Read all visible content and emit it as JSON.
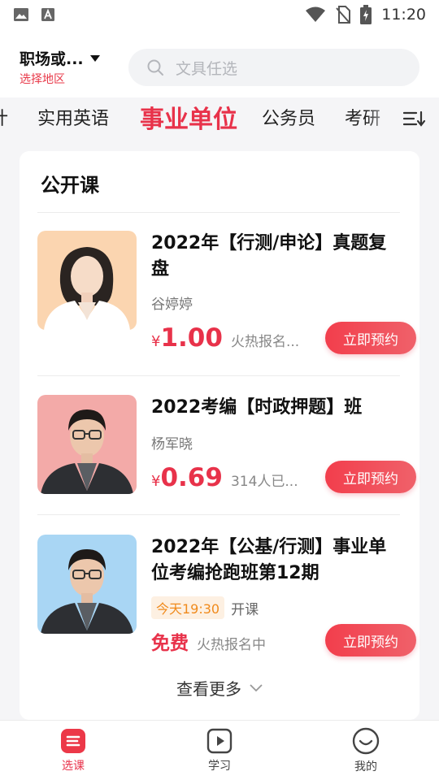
{
  "status_bar": {
    "time": "11:20"
  },
  "header": {
    "region_name": "职场或...",
    "region_sub": "选择地区",
    "search_placeholder": "文具任选"
  },
  "tabs": {
    "items": [
      "计",
      "实用英语",
      "事业单位",
      "公务员",
      "考研"
    ],
    "active": "事业单位"
  },
  "card": {
    "title": "公开课",
    "courses": [
      {
        "title": "2022年【行测/申论】真题复盘",
        "teacher": "谷婷婷",
        "price_symbol": "¥",
        "price": "1.00",
        "enroll": "火热报名...",
        "button": "立即预约"
      },
      {
        "title": "2022考编【时政押题】班",
        "teacher": "杨军晓",
        "price_symbol": "¥",
        "price": "0.69",
        "enroll": "314人已...",
        "button": "立即预约"
      },
      {
        "title": "2022年【公基/行测】事业单位考编抢跑班第12期",
        "time_badge": "今天19:30",
        "time_suffix": "开课",
        "price_free": "免费",
        "enroll": "火热报名中",
        "button": "立即预约"
      }
    ],
    "more": "查看更多"
  },
  "bottom_nav": [
    {
      "label": "选课",
      "icon": "course-select-icon",
      "active": true
    },
    {
      "label": "学习",
      "icon": "play-icon",
      "active": false
    },
    {
      "label": "我的",
      "icon": "smile-icon",
      "active": false
    }
  ],
  "colors": {
    "accent": "#e8324a",
    "badge_text": "#f08a1c",
    "badge_bg": "#fdf0e2"
  }
}
